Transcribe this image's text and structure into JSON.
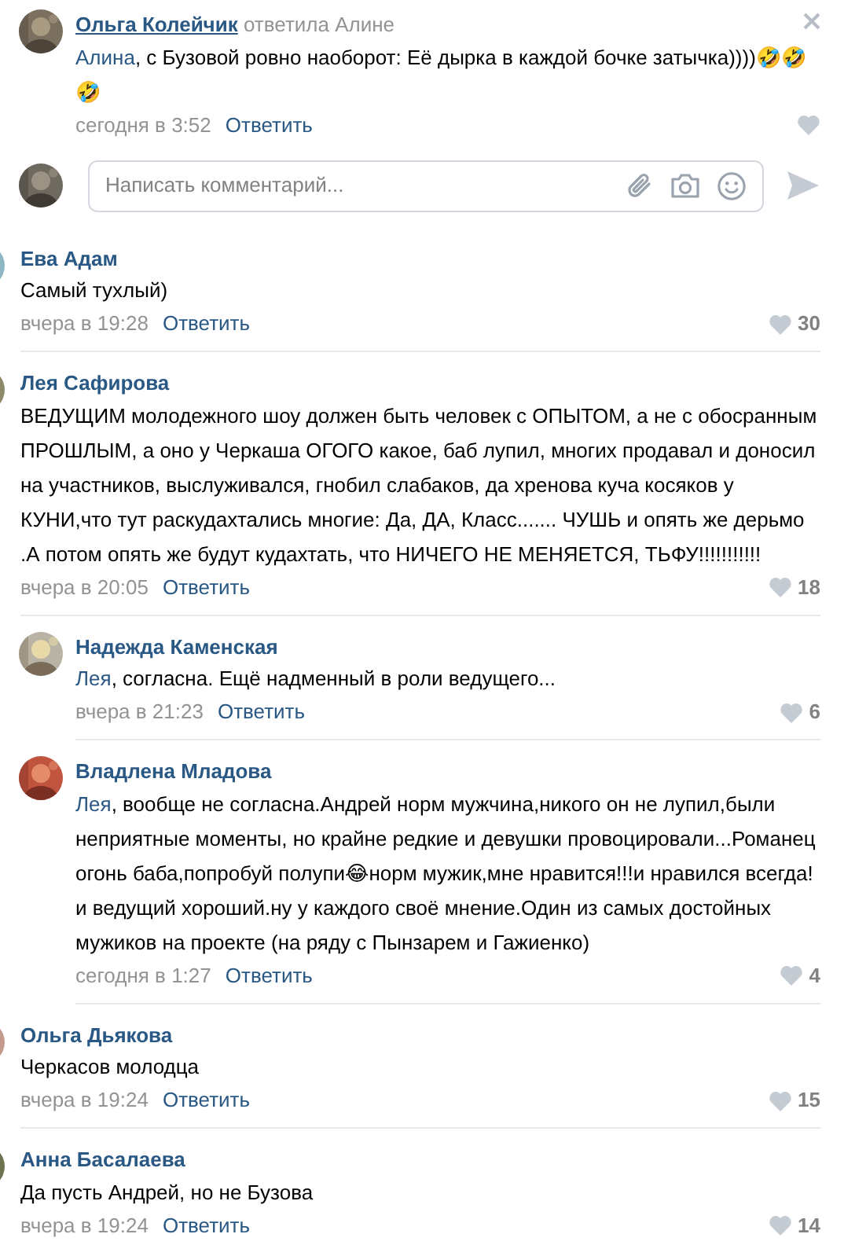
{
  "comments": [
    {
      "kind": "reply",
      "author": "Ольга Колейчик",
      "reply_to": "ответила Алине",
      "mention": "Алина",
      "text": ", с Бузовой ровно наоборот: Её дырка в каждой бочке затычка))))🤣🤣🤣",
      "time": "сегодня в 3:52",
      "reply_link": "Ответить",
      "closable": true
    },
    {
      "kind": "composer",
      "placeholder": "Написать комментарий..."
    },
    {
      "kind": "comment",
      "author": "Ева Адам",
      "text": "Самый тухлый)",
      "time": "вчера в 19:28",
      "reply_link": "Ответить",
      "likes": "30"
    },
    {
      "kind": "comment",
      "author": "Лея Сафирова",
      "text": "ВЕДУЩИМ молодежного шоу должен быть человек с ОПЫТОМ, а не с обосранным ПРОШЛЫМ, а оно у Черкаша ОГОГО какое, баб лупил, многих продавал и доносил на участников, выслуживался, гнобил слабаков, да хренова куча косяков у КУНИ,что тут раскудахтались многие: Да, ДА, Класс....... ЧУШЬ и опять же дерьмо .А потом опять же будут кудахтать, что НИЧЕГО НЕ МЕНЯЕТСЯ, ТЬФУ!!!!!!!!!!!",
      "time": "вчера в 20:05",
      "reply_link": "Ответить",
      "likes": "18"
    },
    {
      "kind": "reply",
      "author": "Надежда Каменская",
      "mention": "Лея",
      "text": ", согласна. Ещё надменный в роли ведущего...",
      "time": "вчера в 21:23",
      "reply_link": "Ответить",
      "likes": "6"
    },
    {
      "kind": "reply",
      "author": "Владлена Младова",
      "mention": "Лея",
      "text": ", вообще не согласна.Андрей норм мужчина,никого он не лупил,были неприятные моменты, но крайне редкие и девушки провоцировали...Романец огонь баба,попробуй полупи😂норм мужик,мне нравится!!!и нравился всегда!и ведущий хороший.ну у каждого своё мнение.Один из самых достойных мужиков на проекте (на ряду с Пынзарем и Гажиенко)",
      "time": "сегодня в 1:27",
      "reply_link": "Ответить",
      "likes": "4"
    },
    {
      "kind": "comment",
      "author": "Ольга Дьякова",
      "text": "Черкасов молодца",
      "time": "вчера в 19:24",
      "reply_link": "Ответить",
      "likes": "15"
    },
    {
      "kind": "comment",
      "author": "Анна Басалаева",
      "text": "Да пусть Андрей, но не Бузова",
      "time": "вчера в 19:24",
      "reply_link": "Ответить",
      "likes": "14"
    }
  ]
}
